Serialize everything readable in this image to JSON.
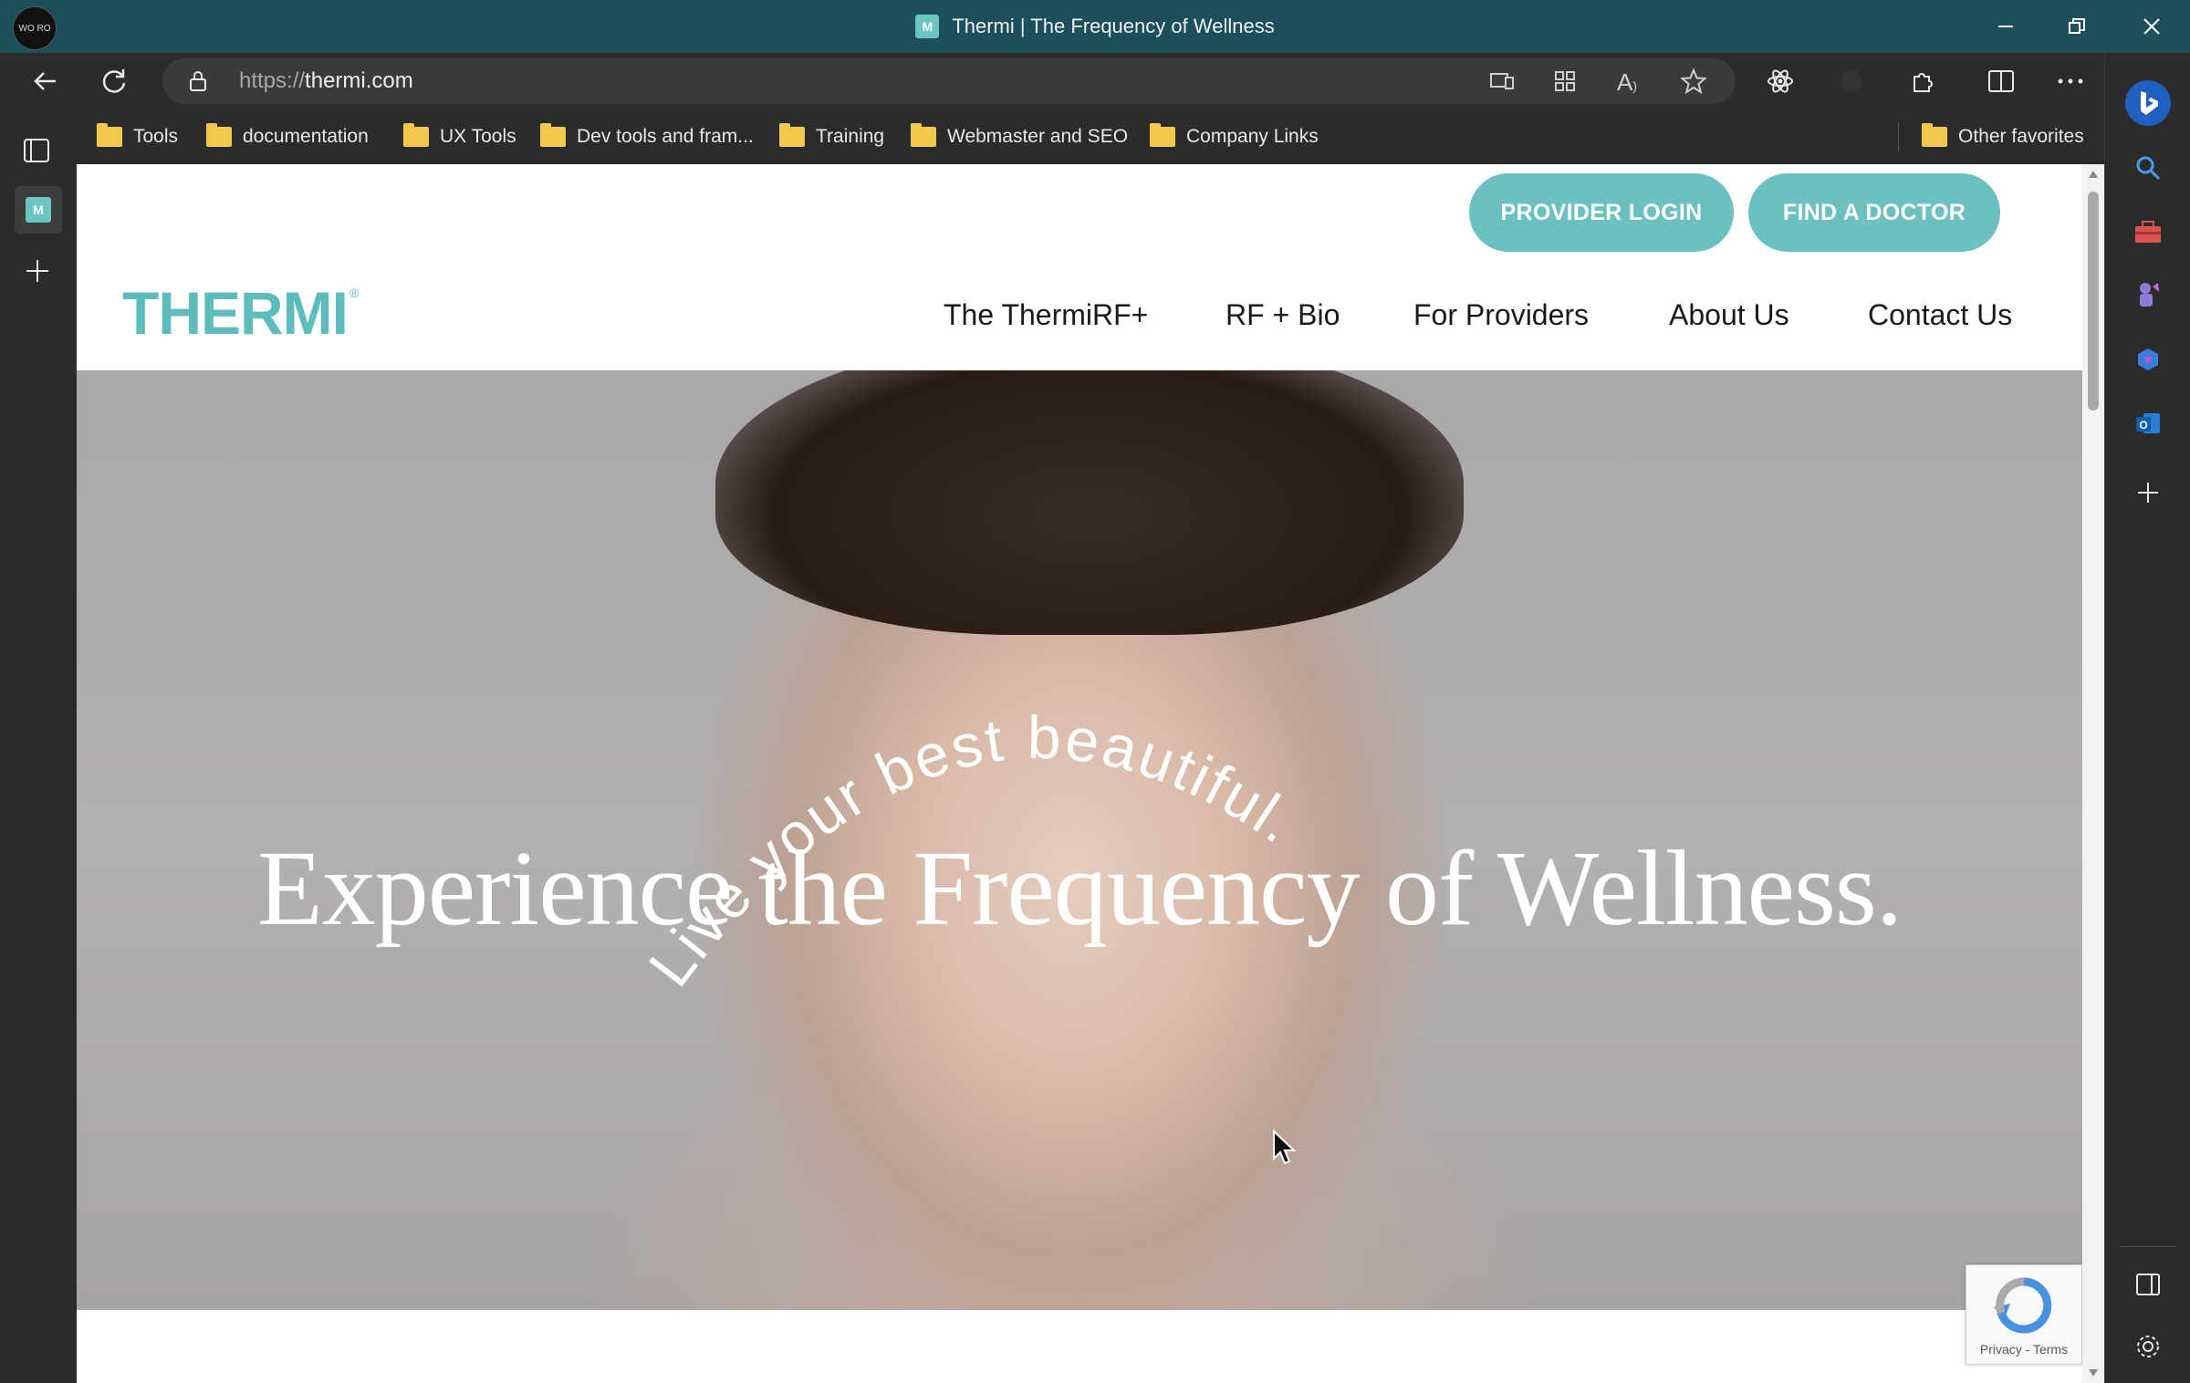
{
  "window": {
    "title": "Thermi | The Frequency of Wellness",
    "profile_text": "WO RO"
  },
  "toolbar": {
    "url_scheme": "https://",
    "url_host": "thermi.com"
  },
  "bookmarks": [
    {
      "label": "Tools"
    },
    {
      "label": "documentation"
    },
    {
      "label": "UX Tools"
    },
    {
      "label": "Dev tools and fram..."
    },
    {
      "label": "Training"
    },
    {
      "label": "Webmaster and SEO"
    },
    {
      "label": "Company Links"
    }
  ],
  "other_favorites": "Other favorites",
  "site": {
    "logo": "THERMI",
    "logo_mark": "®",
    "buttons": {
      "provider_login": "PROVIDER LOGIN",
      "find_doctor": "FIND A DOCTOR"
    },
    "nav": [
      {
        "label": "The ThermiRF+"
      },
      {
        "label": "RF + Bio"
      },
      {
        "label": "For Providers"
      },
      {
        "label": "About Us"
      },
      {
        "label": "Contact Us"
      }
    ],
    "hero": {
      "tagline": "Live your best beautiful.",
      "headline": "Experience the Frequency of Wellness."
    },
    "recaptcha": {
      "links": "Privacy - Terms"
    }
  },
  "colors": {
    "brand_teal": "#6cc0c0",
    "titlebar": "#1b4f5c",
    "chrome": "#2b2b2b"
  }
}
